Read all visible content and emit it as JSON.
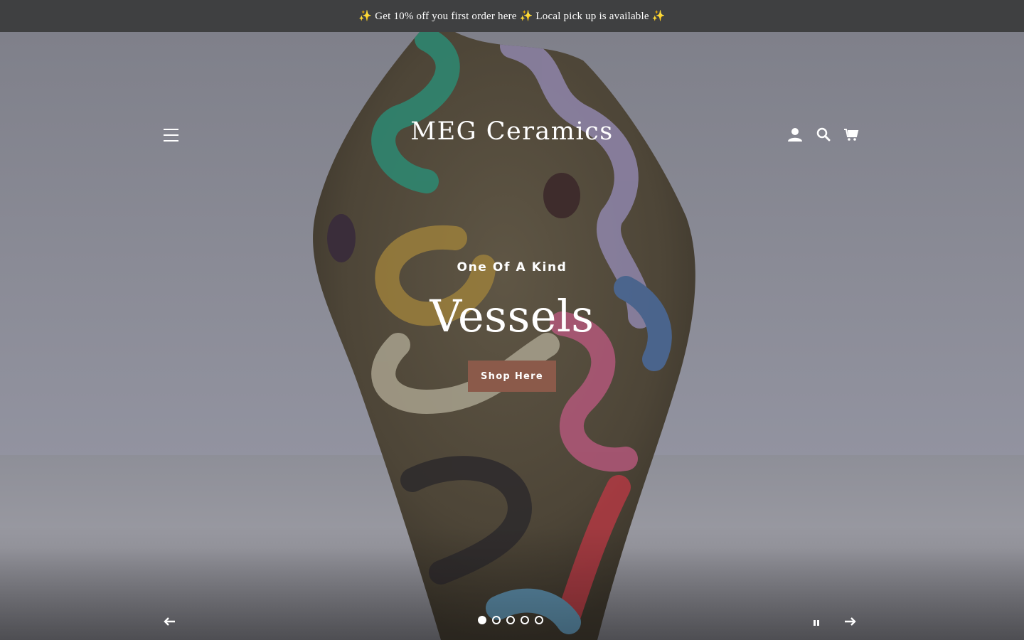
{
  "announcement": {
    "text": "✨ Get 10% off you first order here ✨ Local pick up is available ✨"
  },
  "header": {
    "logo": "MEG Ceramics",
    "icons": {
      "menu": "hamburger-menu-icon",
      "account": "person-icon",
      "search": "search-icon",
      "cart": "cart-icon"
    }
  },
  "slideshow": {
    "subheading": "One Of A Kind",
    "heading": "Vessels",
    "button_label": "Shop Here",
    "slides_total": 5,
    "current_slide": 1,
    "controls": {
      "prev": "arrow-left-icon",
      "next": "arrow-right-icon",
      "pause": "pause-icon"
    }
  },
  "colors": {
    "announcement_bg": "#3f4041",
    "button_bg": "#8b5a4a",
    "text": "#ffffff"
  }
}
